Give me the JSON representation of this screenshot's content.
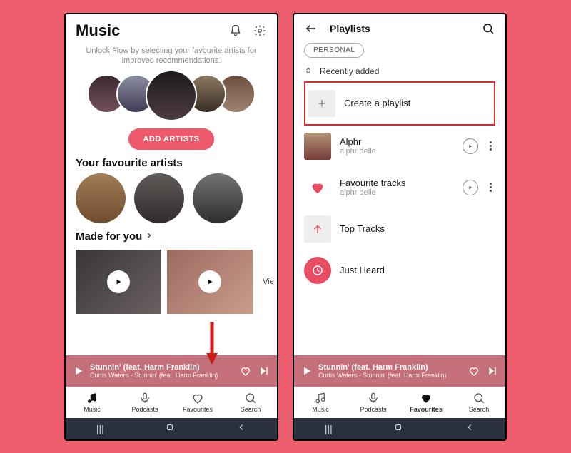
{
  "left": {
    "header": {
      "title": "Music"
    },
    "unlock_text": "Unlock Flow by selecting your favourite artists for improved recommendations.",
    "add_artists_btn": "ADD ARTISTS",
    "fav_artists_title": "Your favourite artists",
    "made_for_you_title": "Made for you",
    "view_more": "Vie",
    "now_playing": {
      "title": "Stunnin' (feat. Harm Franklin)",
      "subtitle": "Curtis Waters - Stunnin' (feat. Harm Franklin)"
    },
    "tabs": [
      "Music",
      "Podcasts",
      "Favourites",
      "Search"
    ]
  },
  "right": {
    "back_label": "Playlists",
    "chip": "PERSONAL",
    "sort_label": "Recently added",
    "create_label": "Create a playlist",
    "playlists": [
      {
        "title": "Alphr",
        "subtitle": "alphr delle"
      },
      {
        "title": "Favourite tracks",
        "subtitle": "alphr delle"
      },
      {
        "title": "Top Tracks",
        "subtitle": ""
      },
      {
        "title": "Just Heard",
        "subtitle": ""
      }
    ],
    "now_playing": {
      "title": "Stunnin' (feat. Harm Franklin)",
      "subtitle": "Curtis Waters - Stunnin' (feat. Harm Franklin)"
    },
    "tabs": [
      "Music",
      "Podcasts",
      "Favourites",
      "Search"
    ]
  }
}
